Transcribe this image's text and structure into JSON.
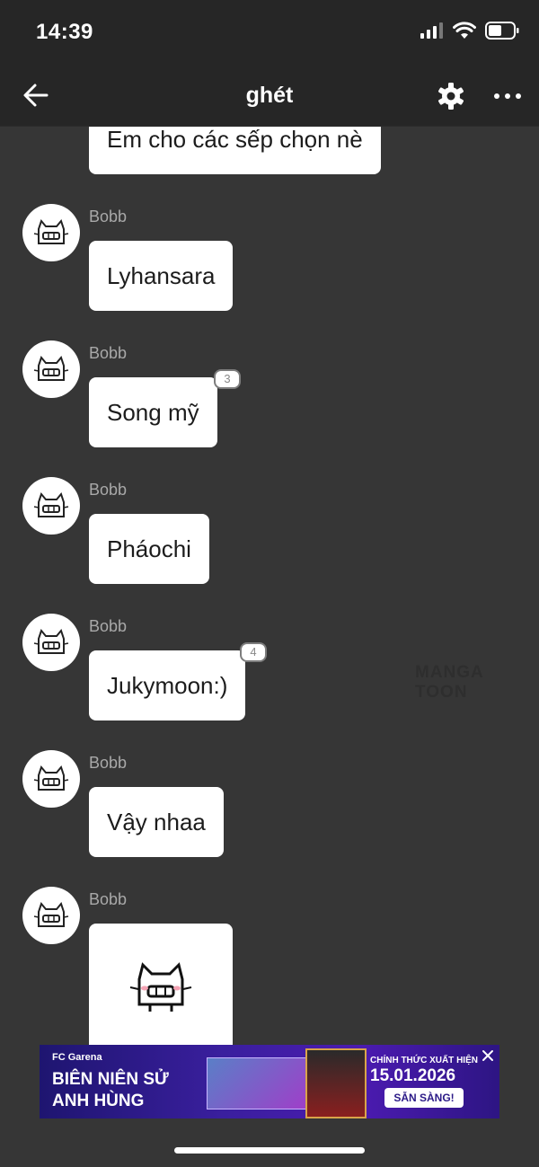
{
  "status_bar": {
    "time": "14:39"
  },
  "header": {
    "title": "ghét"
  },
  "messages": [
    {
      "text": "Em cho các sếp chọn nè"
    },
    {
      "sender": "Bobb",
      "text": "Lyhansara"
    },
    {
      "sender": "Bobb",
      "text": "Song mỹ",
      "count": "3"
    },
    {
      "sender": "Bobb",
      "text": "Pháochi"
    },
    {
      "sender": "Bobb",
      "text": "Jukymoon:)",
      "count": "4"
    },
    {
      "sender": "Bobb",
      "text": "Vậy nhaa"
    },
    {
      "sender": "Bobb",
      "sticker": "cat-sticker"
    }
  ],
  "watermark": "MANGA TOON",
  "ad": {
    "logo": "FC Garena",
    "line1": "BIÊN NIÊN SỬ",
    "line2": "ANH HÙNG",
    "subtitle": "CHÍNH THỨC XUẤT HIỆN",
    "date": "15.01.2026",
    "cta": "SẴN SÀNG!"
  }
}
